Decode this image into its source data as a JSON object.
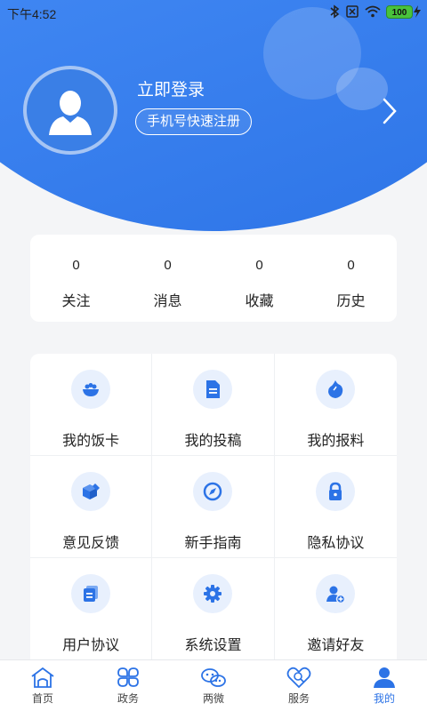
{
  "status_bar": {
    "time": "下午4:52",
    "battery": "100"
  },
  "profile": {
    "login_text": "立即登录",
    "register_text": "手机号快速注册"
  },
  "stats": [
    {
      "value": "0",
      "label": "关注"
    },
    {
      "value": "0",
      "label": "消息"
    },
    {
      "value": "0",
      "label": "收藏"
    },
    {
      "value": "0",
      "label": "历史"
    }
  ],
  "menu": [
    {
      "label": "我的饭卡",
      "icon": "rice-bowl-icon"
    },
    {
      "label": "我的投稿",
      "icon": "document-icon"
    },
    {
      "label": "我的报料",
      "icon": "flame-icon"
    },
    {
      "label": "意见反馈",
      "icon": "feedback-box-icon"
    },
    {
      "label": "新手指南",
      "icon": "compass-icon"
    },
    {
      "label": "隐私协议",
      "icon": "lock-icon"
    },
    {
      "label": "用户协议",
      "icon": "agreement-icon"
    },
    {
      "label": "系统设置",
      "icon": "gear-icon"
    },
    {
      "label": "邀请好友",
      "icon": "invite-user-icon"
    }
  ],
  "tabs": [
    {
      "label": "首页",
      "icon": "home-icon",
      "active": false
    },
    {
      "label": "政务",
      "icon": "clover-icon",
      "active": false
    },
    {
      "label": "两微",
      "icon": "weibo-wechat-icon",
      "active": false
    },
    {
      "label": "服务",
      "icon": "heart-service-icon",
      "active": false
    },
    {
      "label": "我的",
      "icon": "user-icon",
      "active": true
    }
  ],
  "colors": {
    "primary": "#3f86f2",
    "icon_bg": "#e8f0fd",
    "icon": "#2c73e6"
  }
}
